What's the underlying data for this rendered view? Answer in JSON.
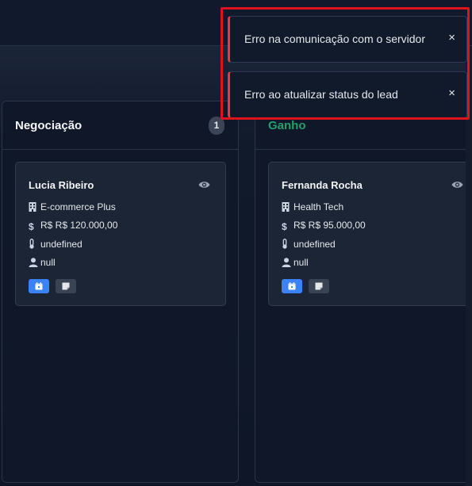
{
  "columns": [
    {
      "title": "Negociação",
      "count": "1",
      "cards": [
        {
          "name": "Lucia Ribeiro",
          "company": "E-commerce Plus",
          "value": "R$ R$ 120.000,00",
          "temperature": "undefined",
          "owner": "null"
        }
      ]
    },
    {
      "title": "Ganho",
      "cards": [
        {
          "name": "Fernanda Rocha",
          "company": "Health Tech",
          "value": "R$ R$ 95.000,00",
          "temperature": "undefined",
          "owner": "null"
        }
      ]
    }
  ],
  "toasts": [
    {
      "message": "Erro na comunicação com o servidor",
      "close": "×"
    },
    {
      "message": "Erro ao atualizar status do lead",
      "close": "×"
    }
  ],
  "icons": {
    "view": "eye-icon",
    "company": "building-icon",
    "value": "dollar-icon",
    "temperature": "thermometer-icon",
    "owner": "user-icon",
    "schedule": "calendar-icon",
    "notes": "note-icon"
  },
  "colors": {
    "won_title": "#22a06b",
    "primary_button": "#3b82f6",
    "error_accent": "#e53944",
    "highlight": "#e0121c"
  }
}
